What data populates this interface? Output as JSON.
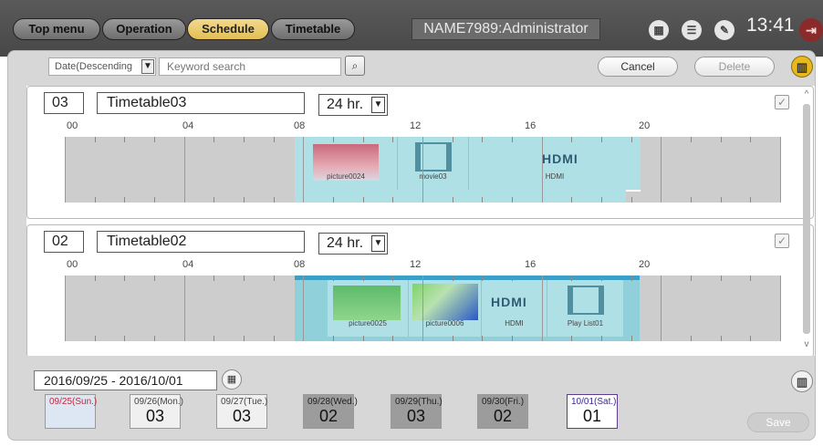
{
  "nav": {
    "top_menu": "Top menu",
    "operation": "Operation",
    "schedule": "Schedule",
    "timetable": "Timetable",
    "user": "NAME7989:Administrator",
    "time": "13:41"
  },
  "toolbar": {
    "sort_value": "Date(Descending",
    "search_placeholder": "Keyword search",
    "cancel": "Cancel",
    "delete": "Delete"
  },
  "hours": [
    "00",
    "04",
    "08",
    "12",
    "16",
    "20"
  ],
  "timetables": [
    {
      "number": "03",
      "name": "Timetable03",
      "hours_option": "24 hr.",
      "segments": [
        {
          "label": "picture0024",
          "kind": "picture-red"
        },
        {
          "label": "movie03",
          "kind": "movie"
        },
        {
          "label": "HDMI",
          "kind": "hdmi"
        }
      ]
    },
    {
      "number": "02",
      "name": "Timetable02",
      "hours_option": "24 hr.",
      "segments": [
        {
          "label": "picture0025",
          "kind": "picture-green"
        },
        {
          "label": "picture0006",
          "kind": "picture-gradient"
        },
        {
          "label": "HDMI",
          "kind": "hdmi"
        },
        {
          "label": "Play List01",
          "kind": "playlist"
        }
      ]
    }
  ],
  "week": {
    "range": "2016/09/25 - 2016/10/01",
    "days": [
      {
        "label": "09/25(Sun.)",
        "value": ""
      },
      {
        "label": "09/26(Mon.)",
        "value": "03"
      },
      {
        "label": "09/27(Tue.)",
        "value": "03"
      },
      {
        "label": "09/28(Wed.)",
        "value": "02"
      },
      {
        "label": "09/29(Thu.)",
        "value": "03"
      },
      {
        "label": "09/30(Fri.)",
        "value": "02"
      },
      {
        "label": "10/01(Sat.)",
        "value": "01"
      }
    ],
    "save": "Save"
  },
  "colors": {
    "accent": "#e3be55",
    "segment": "#afe0e6",
    "header": "#4f4f4f"
  }
}
